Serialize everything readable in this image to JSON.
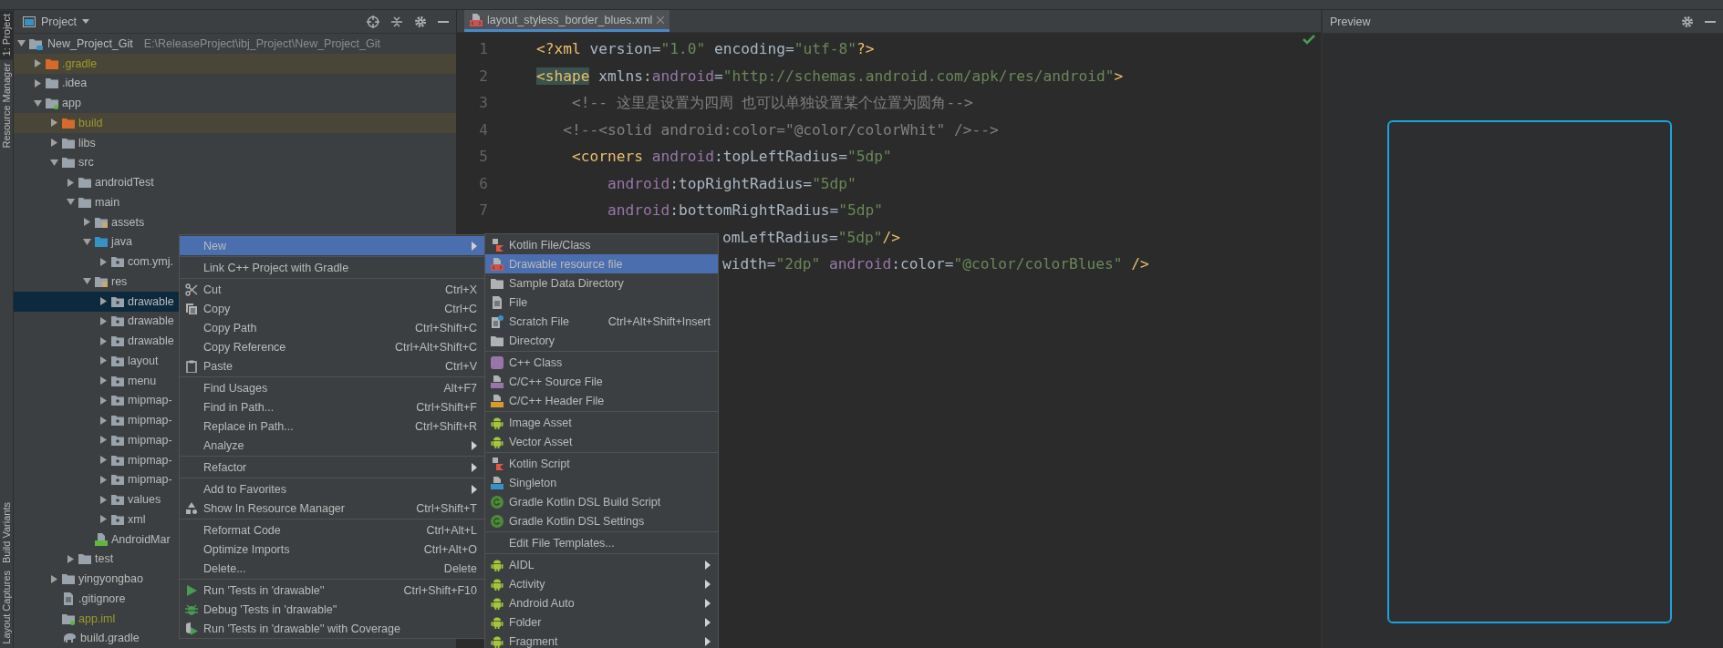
{
  "tool_strip": {
    "top": [
      {
        "label": "1: Project",
        "selected": true
      },
      {
        "label": "Resource Manager",
        "selected": false
      }
    ],
    "bottom": [
      {
        "label": "Build Variants",
        "selected": false
      },
      {
        "label": "Layout Captures",
        "selected": false
      }
    ]
  },
  "project_panel": {
    "title": "Project",
    "tree": [
      {
        "name": "New_Project_Git",
        "path": "E:\\ReleaseProject\\ibj_Project\\New_Project_Git",
        "kind": "project",
        "expanded": true,
        "selected": false,
        "children": [
          {
            "name": ".gradle",
            "kind": "excluded",
            "expanded": false,
            "selected": false
          },
          {
            "name": ".idea",
            "kind": "folder",
            "expanded": false,
            "selected": false
          },
          {
            "name": "app",
            "kind": "module",
            "expanded": true,
            "selected": false,
            "children": [
              {
                "name": "build",
                "kind": "excluded",
                "expanded": false,
                "selected": false
              },
              {
                "name": "libs",
                "kind": "folder",
                "expanded": false,
                "selected": false
              },
              {
                "name": "src",
                "kind": "folder",
                "expanded": true,
                "selected": false,
                "children": [
                  {
                    "name": "androidTest",
                    "kind": "folder",
                    "expanded": false,
                    "selected": false
                  },
                  {
                    "name": "main",
                    "kind": "folder",
                    "expanded": true,
                    "selected": false,
                    "children": [
                      {
                        "name": "assets",
                        "kind": "resources",
                        "expanded": false,
                        "selected": false
                      },
                      {
                        "name": "java",
                        "kind": "source",
                        "expanded": true,
                        "selected": false,
                        "children": [
                          {
                            "name": "com.ymj.",
                            "kind": "package",
                            "expanded": false,
                            "selected": false
                          }
                        ]
                      },
                      {
                        "name": "res",
                        "kind": "resources",
                        "expanded": true,
                        "selected": false,
                        "children": [
                          {
                            "name": "drawable",
                            "kind": "package",
                            "expanded": false,
                            "selected": true
                          },
                          {
                            "name": "drawable",
                            "kind": "package",
                            "expanded": false,
                            "selected": false
                          },
                          {
                            "name": "drawable",
                            "kind": "package",
                            "expanded": false,
                            "selected": false
                          },
                          {
                            "name": "layout",
                            "kind": "package",
                            "expanded": false,
                            "selected": false
                          },
                          {
                            "name": "menu",
                            "kind": "package",
                            "expanded": false,
                            "selected": false
                          },
                          {
                            "name": "mipmap-",
                            "kind": "package",
                            "expanded": false,
                            "selected": false
                          },
                          {
                            "name": "mipmap-",
                            "kind": "package",
                            "expanded": false,
                            "selected": false
                          },
                          {
                            "name": "mipmap-",
                            "kind": "package",
                            "expanded": false,
                            "selected": false
                          },
                          {
                            "name": "mipmap-",
                            "kind": "package",
                            "expanded": false,
                            "selected": false
                          },
                          {
                            "name": "mipmap-",
                            "kind": "package",
                            "expanded": false,
                            "selected": false
                          },
                          {
                            "name": "values",
                            "kind": "package",
                            "expanded": false,
                            "selected": false
                          },
                          {
                            "name": "xml",
                            "kind": "package",
                            "expanded": false,
                            "selected": false
                          }
                        ]
                      },
                      {
                        "name": "AndroidMar",
                        "kind": "manifest",
                        "selected": false
                      }
                    ]
                  },
                  {
                    "name": "test",
                    "kind": "folder",
                    "expanded": false,
                    "selected": false
                  }
                ]
              },
              {
                "name": "yingyongbao",
                "kind": "folder",
                "expanded": false,
                "selected": false
              },
              {
                "name": ".gitignore",
                "kind": "file",
                "selected": false
              },
              {
                "name": "app.iml",
                "kind": "iml",
                "selected": false
              },
              {
                "name": "build.gradle",
                "kind": "gradle",
                "selected": false
              }
            ]
          }
        ]
      }
    ]
  },
  "editor": {
    "tab": {
      "label": "layout_styless_border_blues.xml",
      "selected": true
    },
    "lines": [
      {
        "number": "1",
        "kind": "full",
        "tokens": [
          {
            "kind": "tag",
            "text": "<?xml"
          },
          {
            "kind": "plain",
            "text": " version="
          },
          {
            "kind": "value",
            "text": "\"1.0\""
          },
          {
            "kind": "plain",
            "text": " encoding="
          },
          {
            "kind": "value",
            "text": "\"utf-8\""
          },
          {
            "kind": "tag",
            "text": "?>"
          }
        ]
      },
      {
        "number": "2",
        "kind": "full",
        "tokens": [
          {
            "kind": "match",
            "text": "<shape"
          },
          {
            "kind": "plain",
            "text": " xmlns:"
          },
          {
            "kind": "attr",
            "text": "android"
          },
          {
            "kind": "plain",
            "text": "="
          },
          {
            "kind": "value",
            "text": "\"http://schemas.android.com/apk/res/android\""
          },
          {
            "kind": "tag",
            "text": ">"
          }
        ]
      },
      {
        "number": "3",
        "kind": "full",
        "tokens": [
          {
            "kind": "comment",
            "text": "    <!-- 这里是设置为四周 也可以单独设置某个位置为圆角-->"
          }
        ]
      },
      {
        "number": "4",
        "kind": "full",
        "tokens": [
          {
            "kind": "comment",
            "text": "   <!--<solid android:color=\"@color/colorWhit\" />-->"
          }
        ]
      },
      {
        "number": "5",
        "kind": "full",
        "tokens": [
          {
            "kind": "tag",
            "text": "    <corners"
          },
          {
            "kind": "attr",
            "text": " android"
          },
          {
            "kind": "plain",
            "text": ":topLeftRadius="
          },
          {
            "kind": "value",
            "text": "\"5dp\""
          }
        ]
      },
      {
        "number": "6",
        "kind": "full",
        "tokens": [
          {
            "kind": "attr",
            "text": "        android"
          },
          {
            "kind": "plain",
            "text": ":topRightRadius="
          },
          {
            "kind": "value",
            "text": "\"5dp\""
          }
        ]
      },
      {
        "number": "7",
        "kind": "full",
        "tokens": [
          {
            "kind": "attr",
            "text": "        android"
          },
          {
            "kind": "plain",
            "text": ":bottomRightRadius="
          },
          {
            "kind": "value",
            "text": "\"5dp\""
          }
        ]
      },
      {
        "kind": "partial",
        "tokens": [
          {
            "kind": "plain",
            "text": "omLeftRadius="
          },
          {
            "kind": "value",
            "text": "\"5dp\""
          },
          {
            "kind": "tag",
            "text": "/>"
          }
        ]
      },
      {
        "kind": "partial",
        "tokens": [
          {
            "kind": "plain",
            "text": "width="
          },
          {
            "kind": "value",
            "text": "\"2dp\""
          },
          {
            "kind": "attr",
            "text": " android"
          },
          {
            "kind": "plain",
            "text": ":color="
          },
          {
            "kind": "value",
            "text": "\"@color/colorBlues\""
          },
          {
            "kind": "tag",
            "text": " />"
          }
        ]
      }
    ]
  },
  "preview": {
    "title": "Preview"
  },
  "context_menu": {
    "groups": [
      [
        {
          "label": "New",
          "submenu": true,
          "selected": true
        }
      ],
      [
        {
          "label": "Link C++ Project with Gradle",
          "submenu": false,
          "selected": false
        }
      ],
      [
        {
          "label": "Cut",
          "shortcut": "Ctrl+X",
          "submenu": false,
          "selected": false
        },
        {
          "label": "Copy",
          "shortcut": "Ctrl+C",
          "submenu": false,
          "selected": false
        },
        {
          "label": "Copy Path",
          "shortcut": "Ctrl+Shift+C",
          "submenu": false,
          "selected": false
        },
        {
          "label": "Copy Reference",
          "shortcut": "Ctrl+Alt+Shift+C",
          "submenu": false,
          "selected": false
        },
        {
          "label": "Paste",
          "shortcut": "Ctrl+V",
          "submenu": false,
          "selected": false
        }
      ],
      [
        {
          "label": "Find Usages",
          "shortcut": "Alt+F7",
          "submenu": false,
          "selected": false
        },
        {
          "label": "Find in Path...",
          "shortcut": "Ctrl+Shift+F",
          "submenu": false,
          "selected": false
        },
        {
          "label": "Replace in Path...",
          "shortcut": "Ctrl+Shift+R",
          "submenu": false,
          "selected": false
        },
        {
          "label": "Analyze",
          "submenu": true,
          "selected": false
        }
      ],
      [
        {
          "label": "Refactor",
          "submenu": true,
          "selected": false
        }
      ],
      [
        {
          "label": "Add to Favorites",
          "submenu": true,
          "selected": false
        },
        {
          "label": "Show In Resource Manager",
          "shortcut": "Ctrl+Shift+T",
          "submenu": false,
          "selected": false
        }
      ],
      [
        {
          "label": "Reformat Code",
          "shortcut": "Ctrl+Alt+L",
          "submenu": false,
          "selected": false
        },
        {
          "label": "Optimize Imports",
          "shortcut": "Ctrl+Alt+O",
          "submenu": false,
          "selected": false
        },
        {
          "label": "Delete...",
          "shortcut": "Delete",
          "submenu": false,
          "selected": false
        }
      ],
      [
        {
          "label": "Run 'Tests in 'drawable''",
          "shortcut": "Ctrl+Shift+F10",
          "submenu": false,
          "selected": false
        },
        {
          "label": "Debug 'Tests in 'drawable''",
          "submenu": false,
          "selected": false
        },
        {
          "label": "Run 'Tests in 'drawable'' with Coverage",
          "submenu": false,
          "selected": false
        }
      ]
    ]
  },
  "new_submenu": {
    "groups": [
      [
        {
          "label": "Kotlin File/Class",
          "submenu": false,
          "selected": false
        },
        {
          "label": "Drawable resource file",
          "submenu": false,
          "selected": true
        },
        {
          "label": "Sample Data Directory",
          "submenu": false,
          "selected": false
        },
        {
          "label": "File",
          "submenu": false,
          "selected": false
        },
        {
          "label": "Scratch File",
          "shortcut": "Ctrl+Alt+Shift+Insert",
          "submenu": false,
          "selected": false
        },
        {
          "label": "Directory",
          "submenu": false,
          "selected": false
        }
      ],
      [
        {
          "label": "C++ Class",
          "submenu": false,
          "selected": false
        },
        {
          "label": "C/C++ Source File",
          "submenu": false,
          "selected": false
        },
        {
          "label": "C/C++ Header File",
          "submenu": false,
          "selected": false
        }
      ],
      [
        {
          "label": "Image Asset",
          "submenu": false,
          "selected": false
        },
        {
          "label": "Vector Asset",
          "submenu": false,
          "selected": false
        }
      ],
      [
        {
          "label": "Kotlin Script",
          "submenu": false,
          "selected": false
        },
        {
          "label": "Singleton",
          "submenu": false,
          "selected": false
        },
        {
          "label": "Gradle Kotlin DSL Build Script",
          "submenu": false,
          "selected": false
        },
        {
          "label": "Gradle Kotlin DSL Settings",
          "submenu": false,
          "selected": false
        }
      ],
      [
        {
          "label": "Edit File Templates...",
          "submenu": false,
          "selected": false
        }
      ],
      [
        {
          "label": "AIDL",
          "submenu": true,
          "selected": false
        },
        {
          "label": "Activity",
          "submenu": true,
          "selected": false
        },
        {
          "label": "Android Auto",
          "submenu": true,
          "selected": false
        },
        {
          "label": "Folder",
          "submenu": true,
          "selected": false
        },
        {
          "label": "Fragment",
          "submenu": true,
          "selected": false
        }
      ]
    ]
  }
}
